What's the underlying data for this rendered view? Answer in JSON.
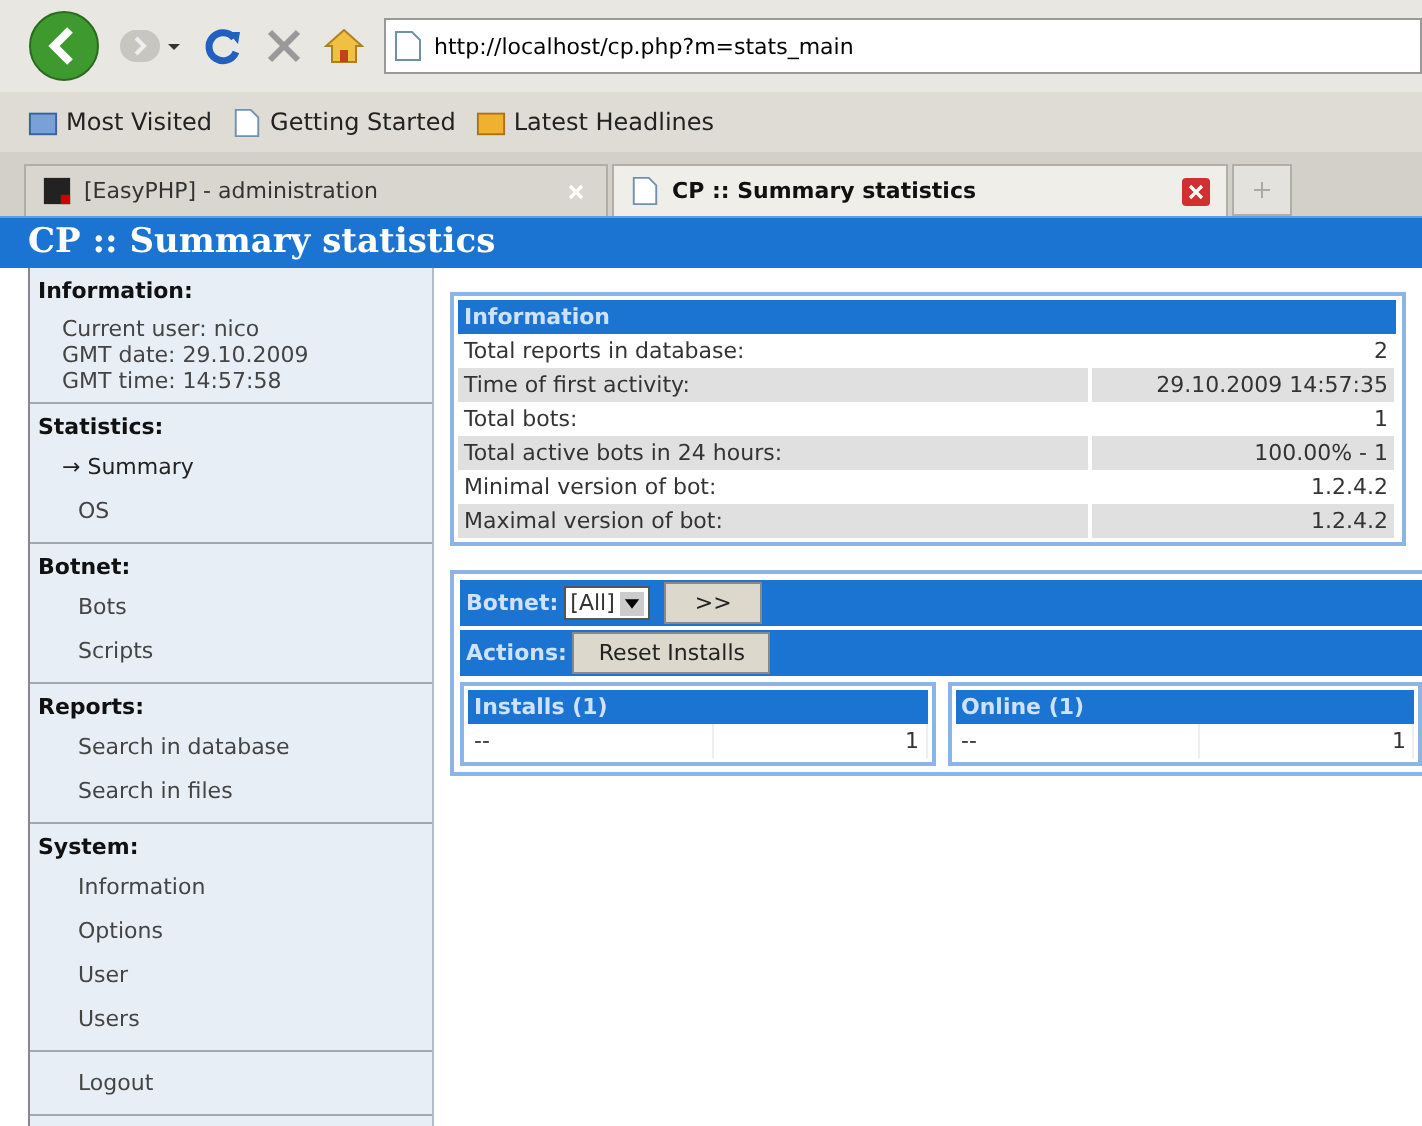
{
  "browser": {
    "url": "http://localhost/cp.php?m=stats_main",
    "bookmarks": [
      {
        "label": "Most Visited",
        "kind": "folder"
      },
      {
        "label": "Getting Started",
        "kind": "page"
      },
      {
        "label": "Latest Headlines",
        "kind": "feed"
      }
    ],
    "tabs": [
      {
        "label": "[EasyPHP] - administration",
        "selected": false
      },
      {
        "label": "CP :: Summary statistics",
        "selected": true
      }
    ]
  },
  "page_title": "CP :: Summary statistics",
  "sidebar": {
    "info": {
      "heading": "Information:",
      "lines": [
        "Current user: nico",
        "GMT date: 29.10.2009",
        "GMT time: 14:57:58"
      ]
    },
    "sections": [
      {
        "heading": "Statistics:",
        "items": [
          {
            "label": "→ Summary",
            "selected": true
          },
          {
            "label": "OS",
            "selected": false
          }
        ]
      },
      {
        "heading": "Botnet:",
        "items": [
          {
            "label": "Bots",
            "selected": false
          },
          {
            "label": "Scripts",
            "selected": false
          }
        ]
      },
      {
        "heading": "Reports:",
        "items": [
          {
            "label": "Search in database",
            "selected": false
          },
          {
            "label": "Search in files",
            "selected": false
          }
        ]
      },
      {
        "heading": "System:",
        "items": [
          {
            "label": "Information",
            "selected": false
          },
          {
            "label": "Options",
            "selected": false
          },
          {
            "label": "User",
            "selected": false
          },
          {
            "label": "Users",
            "selected": false
          }
        ]
      },
      {
        "items": [
          {
            "label": "Logout",
            "selected": false
          }
        ]
      }
    ]
  },
  "info_table": {
    "title": "Information",
    "rows": [
      {
        "label": "Total reports in database:",
        "value": "2"
      },
      {
        "label": "Time of first activity:",
        "value": "29.10.2009 14:57:35"
      },
      {
        "label": "Total bots:",
        "value": "1"
      },
      {
        "label": "Total active bots in 24 hours:",
        "value": "100.00% - 1"
      },
      {
        "label": "Minimal version of bot:",
        "value": "1.2.4.2"
      },
      {
        "label": "Maximal version of bot:",
        "value": "1.2.4.2"
      }
    ]
  },
  "filter": {
    "botnet_label": "Botnet:",
    "botnet_value": "[All]",
    "go_button": ">>",
    "actions_label": "Actions:",
    "action_button": "Reset Installs"
  },
  "lists": [
    {
      "title": "Installs (1)",
      "rows": [
        {
          "name": "--",
          "count": "1"
        }
      ]
    },
    {
      "title": "Online (1)",
      "rows": [
        {
          "name": "--",
          "count": "1"
        }
      ]
    }
  ]
}
